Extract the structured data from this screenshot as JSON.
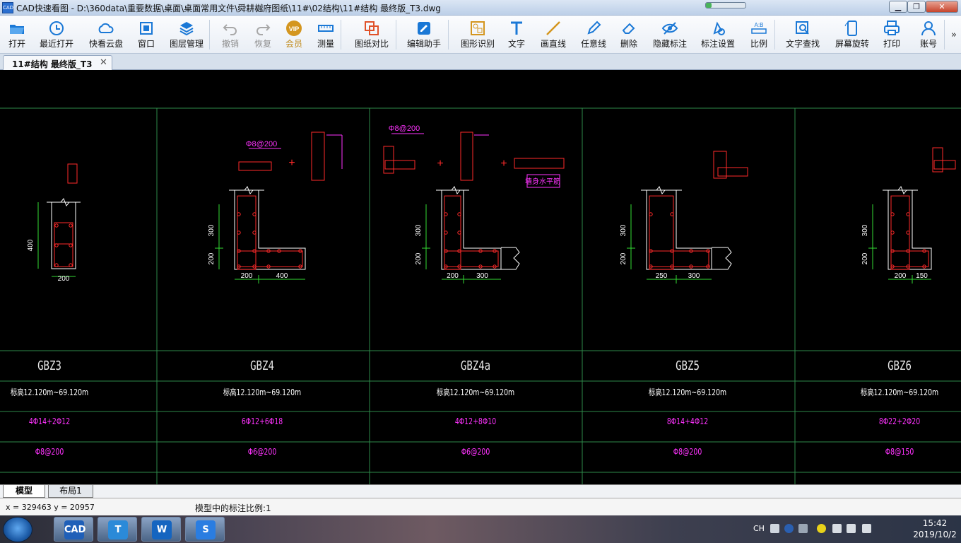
{
  "window": {
    "title": "CAD快速看图 - D:\\360data\\重要数据\\桌面\\桌面常用文件\\舜耕樾府图纸\\11#\\02结构\\11#结构 最终版_T3.dwg",
    "min_label": "▁",
    "max_label": "❐",
    "close_label": "✕",
    "app_icon_text": "CAD",
    "progress_fraction": 0.15
  },
  "toolbar": {
    "items": [
      {
        "label": "打开",
        "icon": "folder-open-icon"
      },
      {
        "label": "最近打开",
        "icon": "recent-icon"
      },
      {
        "label": "快看云盘",
        "icon": "cloud-icon"
      },
      {
        "label": "窗口",
        "icon": "window-icon"
      },
      {
        "label": "图层管理",
        "icon": "layers-icon"
      },
      {
        "label": "撤销",
        "icon": "undo-icon"
      },
      {
        "label": "恢复",
        "icon": "redo-icon"
      },
      {
        "label": "会员",
        "icon": "vip-icon"
      },
      {
        "label": "测量",
        "icon": "measure-icon"
      },
      {
        "label": "图纸对比",
        "icon": "compare-icon"
      },
      {
        "label": "编辑助手",
        "icon": "edit-assistant-icon"
      },
      {
        "label": "图形识别",
        "icon": "shape-recognize-icon"
      },
      {
        "label": "文字",
        "icon": "text-icon"
      },
      {
        "label": "画直线",
        "icon": "line-icon"
      },
      {
        "label": "任意线",
        "icon": "pen-icon"
      },
      {
        "label": "删除",
        "icon": "eraser-icon"
      },
      {
        "label": "隐藏标注",
        "icon": "hide-annotation-icon"
      },
      {
        "label": "标注设置",
        "icon": "annotation-settings-icon"
      },
      {
        "label": "比例",
        "icon": "scale-icon"
      },
      {
        "label": "文字查找",
        "icon": "text-search-icon"
      },
      {
        "label": "屏幕旋转",
        "icon": "rotate-screen-icon"
      },
      {
        "label": "打印",
        "icon": "print-icon"
      },
      {
        "label": "账号",
        "icon": "account-icon"
      }
    ],
    "more_label": "»",
    "colors": {
      "blue": "#1a78d6",
      "disabled": "#a8a8a8",
      "vip": "#d4961f",
      "accent_red": "#e0522a"
    }
  },
  "document_tab": {
    "label": "11#结构  最终版_T3",
    "close": "✕"
  },
  "drawing": {
    "colors": {
      "frame": "#2e8a4a",
      "outline": "#ffffff",
      "rebar": "#ff2a2a",
      "dimension": "#33dd33",
      "annotation": "#ff33ff",
      "text": "#ffffff"
    },
    "dim_header": "200",
    "detail_labels": {
      "gbz4_stirrup": "Φ8@200",
      "gbz4a_stirrup": "Φ8@200",
      "wall_horizontal_bar": "墙身水平筋"
    },
    "columns": [
      {
        "name": "GBZ3",
        "elevation": "标高12.120m~69.120m",
        "longitudinal": "4Φ14+2Φ12",
        "stirrup": "Φ8@200",
        "dims_x": [
          "200"
        ],
        "dims_y": [
          "400"
        ]
      },
      {
        "name": "GBZ4",
        "elevation": "标高12.120m~69.120m",
        "longitudinal": "6Φ12+6Φ18",
        "stirrup": "Φ6@200",
        "dims_x": [
          "200",
          "400"
        ],
        "dims_y": [
          "300",
          "200"
        ]
      },
      {
        "name": "GBZ4a",
        "elevation": "标高12.120m~69.120m",
        "longitudinal": "4Φ12+8Φ10",
        "stirrup": "Φ6@200",
        "dims_x": [
          "200",
          "300"
        ],
        "dims_y": [
          "300",
          "200"
        ]
      },
      {
        "name": "GBZ5",
        "elevation": "标高12.120m~69.120m",
        "longitudinal": "8Φ14+4Φ12",
        "stirrup": "Φ8@200",
        "dims_x": [
          "250",
          "300"
        ],
        "dims_y": [
          "300",
          "200"
        ]
      },
      {
        "name": "GBZ6",
        "elevation": "标高12.120m~69.120m",
        "longitudinal": "8Φ22+2Φ20",
        "stirrup": "Φ8@150",
        "dims_x": [
          "200",
          "150"
        ],
        "dims_y": [
          "300",
          "200"
        ]
      }
    ]
  },
  "layout_tabs": [
    {
      "label": "模型"
    },
    {
      "label": "布局1"
    }
  ],
  "status": {
    "coords": "x = 329463  y = 20957",
    "scale": "模型中的标注比例:1"
  },
  "taskbar": {
    "apps": [
      {
        "name": "cad-viewer",
        "text": "CAD",
        "color": "#1f5fb8"
      },
      {
        "name": "text-app",
        "text": "T",
        "color": "#2b8ad8"
      },
      {
        "name": "wps-app",
        "text": "W",
        "color": "#1565c0"
      },
      {
        "name": "sogou-app",
        "text": "S",
        "color": "#2a7de1"
      }
    ],
    "ime": "CH",
    "time": "15:42",
    "date": "2019/10/2"
  }
}
